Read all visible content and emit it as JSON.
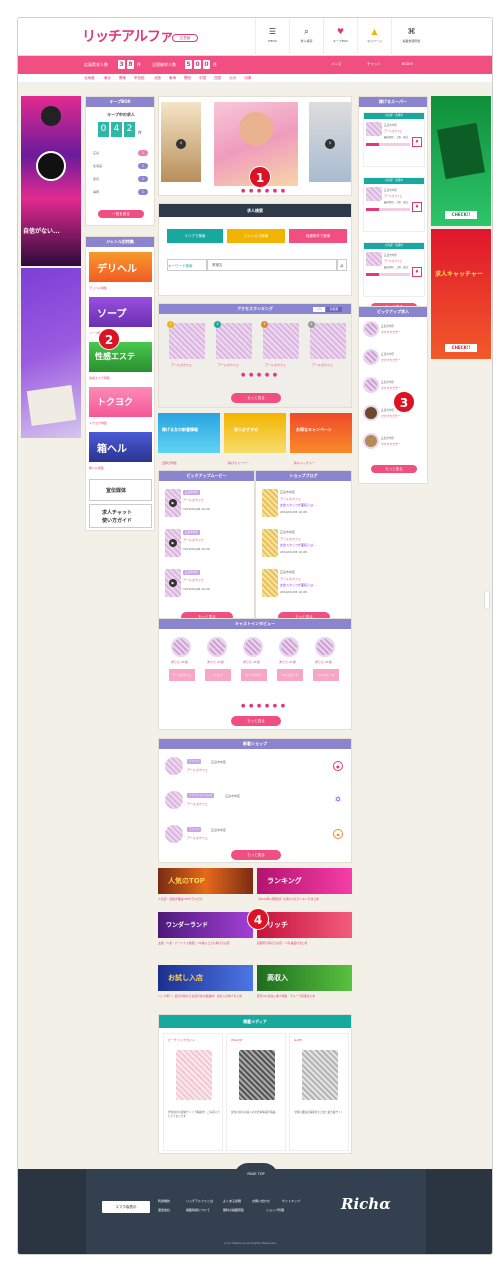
{
  "header": {
    "logo": "リッチアルファ",
    "area": "広島版",
    "nav": [
      {
        "label": "MENU",
        "icon": "menu-icon",
        "glyph": "☰"
      },
      {
        "label": "求人検索",
        "icon": "search-icon",
        "glyph": "⌕"
      },
      {
        "label": "キープBOX",
        "icon": "heart-icon",
        "glyph": "♥"
      },
      {
        "label": "マイページ",
        "icon": "bell-icon",
        "glyph": "🔔"
      },
      {
        "label": "掲載依頼問合",
        "icon": "handshake-icon",
        "glyph": "⌘"
      }
    ]
  },
  "stats": {
    "hiroshima_label": "広島県求人数",
    "hiroshima_digits": [
      "3",
      "8"
    ],
    "hiroshima_unit": "件",
    "national_label": "全国総求人数",
    "national_digits": [
      "5",
      "0",
      "0"
    ],
    "national_unit": "件",
    "links": [
      "メンズ",
      "チャット",
      "BOXHI"
    ]
  },
  "regions": [
    "北海道",
    "東北",
    "関東",
    "甲信越",
    "北陸",
    "東海",
    "関西",
    "中国",
    "四国",
    "九州",
    "沖縄"
  ],
  "keep_box": {
    "title": "キープBOX",
    "subtitle": "キープ中の求人",
    "digits": [
      "0",
      "4",
      "2"
    ],
    "unit": "件",
    "rows": [
      {
        "label": "広島",
        "count": "1"
      },
      {
        "label": "北海道",
        "count": "1"
      },
      {
        "label": "東京",
        "count": "1"
      },
      {
        "label": "静岡",
        "count": "1"
      }
    ],
    "button": "一覧を見る"
  },
  "genre": {
    "title": "ジャンル別特集",
    "items": [
      "デリヘル特集",
      "ソープ特集",
      "性感エステ特集",
      "トクヨク特集",
      "箱ヘル特集"
    ],
    "banner_texts": [
      "デリヘル",
      "ソープ",
      "性感エステ",
      "トクヨク",
      "箱ヘル"
    ],
    "media_banner": "宣伝媒体",
    "chat_banner_line1": "求人チャット",
    "chat_banner_line2": "使い方ガイド"
  },
  "slider": {
    "nav_prev": "‹",
    "nav_next": "›",
    "dots": "● ● ● ● ● ●"
  },
  "search": {
    "title": "求人検索",
    "buttons": [
      "エリアで検索",
      "ジャンルで検索",
      "待遇条件で検索"
    ],
    "keyword_label": "キーワード検索",
    "keyword_placeholder": "業種名"
  },
  "ranking": {
    "title": "アクセスランキング",
    "tabs": [
      "人気",
      "新着順"
    ],
    "items": [
      {
        "rank": "1",
        "name": "アールズカフェ"
      },
      {
        "rank": "2",
        "name": "アールズカフェ"
      },
      {
        "rank": "3",
        "name": "アールズカフェ"
      },
      {
        "rank": "4",
        "name": "アールズカフェ"
      }
    ],
    "more": "もっと見る"
  },
  "feature_cards": [
    {
      "banner": "稼げる女の新着情報",
      "caption": "出稼ぎ特集"
    },
    {
      "banner": "求人おすすめ",
      "caption": "稼げるスーパー"
    },
    {
      "banner": "お得なキャンペーン",
      "caption": "新キャッチャー"
    }
  ],
  "movies": {
    "title": "ピックアップムービー",
    "rows": [
      {
        "tag": "広島市中区",
        "shop": "アールズカフェ",
        "date": "2019/01/08 10:26"
      },
      {
        "tag": "広島市中区",
        "shop": "アールズカフェ",
        "date": "2019/01/08 10:26"
      },
      {
        "tag": "広島市中区",
        "shop": "アールズカフェ",
        "date": "2019/01/08 10:26"
      }
    ],
    "more": "もっと見る"
  },
  "blog": {
    "title": "ショップブログ",
    "rows": [
      {
        "tag": "広島市中区",
        "shop": "アールズカフェ",
        "text": "女性スタッフが面接とは…",
        "date": "2019/01/08 10:26"
      },
      {
        "tag": "広島市中区",
        "shop": "アールズカフェ",
        "text": "女性スタッフが面接とは…",
        "date": "2019/01/08 10:26"
      },
      {
        "tag": "広島市中区",
        "shop": "アールズカフェ",
        "text": "女性スタッフが面接とは…",
        "date": "2019/01/08 10:26"
      }
    ],
    "more": "もっと見る"
  },
  "interview": {
    "title": "キャストインタビュー",
    "items": [
      {
        "name": "ありさ 21歳",
        "shop": "アールズカフェ"
      },
      {
        "name": "ありさ 21歳",
        "shop": "ニコリ"
      },
      {
        "name": "ありさ 21歳",
        "shop": "ピンクリボン"
      },
      {
        "name": "ありさ 21歳",
        "shop": "ベルエポック"
      },
      {
        "name": "ありさ 21歳",
        "shop": "ベルキュール"
      }
    ],
    "dots": "● ● ● ● ● ●",
    "more": "もっと見る"
  },
  "new_shops": {
    "title": "新着ショップ",
    "rows": [
      {
        "tag": "デリヘル",
        "area": "広島市中区",
        "shop": "アールズカフェ"
      },
      {
        "tag": "ファッションヘルス",
        "area": "広島市中区",
        "shop": "アールズカフェ"
      },
      {
        "tag": "デリヘル",
        "area": "広島市中区",
        "shop": "アールズカフェ"
      }
    ],
    "more": "もっと見る"
  },
  "articles": [
    {
      "banner": "人気のTOP",
      "text": "人気店・出稼ぎ優良TOPクラスだけ"
    },
    {
      "banner": "ランキング",
      "text": "【2019年1月更新】今月の人気ランキングまとめ"
    },
    {
      "banner": "ワンダーランド",
      "text": "主婦・人妻・パートナス開拓！ 30歳以上でも稼げるお店"
    },
    {
      "banner": "リッチ",
      "text": "短期間で稼げるお店・人気事業のまとめ"
    },
    {
      "banner": "お試し入店",
      "text": "バック率？！最大の稼げるお店が続々掲載中！高収入の求人まとめ"
    },
    {
      "banner": "高収入",
      "text": "即日OK!高収入求人特集・グループ店舗まとめ"
    }
  ],
  "media": {
    "title": "掲載メディア",
    "cards": [
      {
        "label": "ビーチバックガイド",
        "text": "男性向けの風俗サイトで掲載中！ご好評いただいております"
      },
      {
        "label": "WILLIST",
        "text": "女性の為の高収入のお仕事情報が満載。"
      },
      {
        "label": "GATE",
        "text": "全国の風俗店情報をまとめた最大級サイト"
      }
    ]
  },
  "earn_super": {
    "title": "稼げるスーパー",
    "items": [
      {
        "badge": "大好評・急募中",
        "area": "広島市中区",
        "shop": "アールズカフェ",
        "pay": "最低時給・上限・保証",
        "level": 0.3
      },
      {
        "badge": "大好評・急募中",
        "area": "広島市中区",
        "shop": "アールズカフェ",
        "pay": "最低時給・上限・保証",
        "level": 0.3
      },
      {
        "badge": "大好評・急募中",
        "area": "広島市中区",
        "shop": "アールズカフェ",
        "pay": "最低時給・上限・保証",
        "level": 0.3
      }
    ],
    "more": "もっと見る"
  },
  "pickup": {
    "title": "ピックアップ求人",
    "items": [
      {
        "area": "広島市中区",
        "shop": "マカマカガチー"
      },
      {
        "area": "広島市中区",
        "shop": "マカマカガチー"
      },
      {
        "area": "広島市中区",
        "shop": "マカマカガチー"
      },
      {
        "area": "広島市中区",
        "shop": "マカマカガチー"
      },
      {
        "area": "広島市中区",
        "shop": "マカマカガチー"
      }
    ],
    "more": "もっと見る"
  },
  "right_ads": {
    "ad1_text": "CHECK!!",
    "ad2_line1": "求人キャッチャー",
    "ad2_line2": "CHECK!!"
  },
  "left_ads": {
    "text": "自信がない..."
  },
  "markers": [
    "1",
    "2",
    "3",
    "4"
  ],
  "footer": {
    "pagetop": "PAGE TOP",
    "phone_button": "スマホ版表示",
    "links": [
      "利用規約",
      "リッチアルファとは",
      "よくある質問",
      "お問い合わせ",
      "サイトマップ",
      "運営会社",
      "掲載情報について",
      "無料の掲載募集",
      "ショップ管理"
    ],
    "logo": "Richα",
    "copyright": "(c)richalpha.jp All Rights Reserved."
  },
  "colors": {
    "primary": "#f14f82",
    "box_header": "#8b84cf",
    "search_header": "#2e3a4a",
    "teal": "#17a8a0",
    "footer": "#2b3441"
  }
}
